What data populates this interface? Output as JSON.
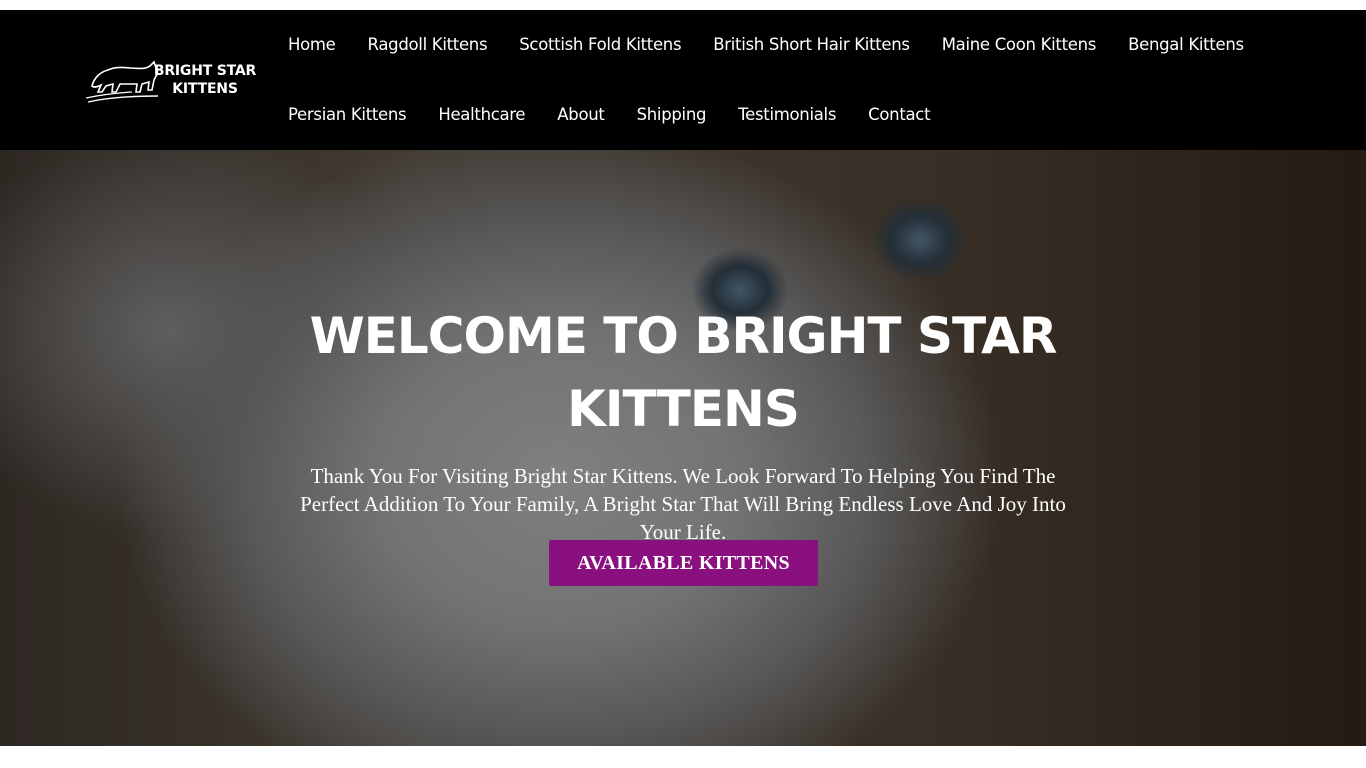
{
  "logo": {
    "line1": "BRIGHT STAR",
    "line2": "KITTENS"
  },
  "nav": {
    "row1": [
      "Home",
      "Ragdoll Kittens",
      "Scottish Fold Kittens",
      "British Short Hair Kittens",
      "Maine Coon Kittens",
      "Bengal Kittens"
    ],
    "row2": [
      "Persian Kittens",
      "Healthcare",
      "About",
      "Shipping",
      "Testimonials",
      "Contact"
    ]
  },
  "hero": {
    "title": "WELCOME TO BRIGHT STAR KITTENS",
    "text": "Thank You For Visiting Bright Star Kittens. We Look Forward To Helping You Find The Perfect Addition To Your Family, A Bright Star That Will Bring Endless Love And Joy Into Your Life.",
    "button_label": "AVAILABLE KITTENS"
  },
  "colors": {
    "header_bg": "#000000",
    "button_bg": "#8a0f7f",
    "text": "#ffffff"
  }
}
